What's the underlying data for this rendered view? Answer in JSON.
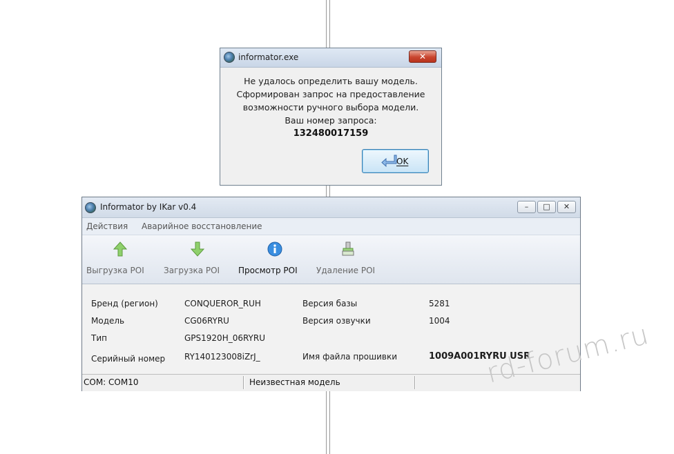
{
  "dialog": {
    "title": "informator.exe",
    "close_glyph": "✕",
    "lines": [
      "Не удалось определить вашу модель.",
      "Сформирован запрос на предоставление",
      "возможности ручного выбора модели.",
      "Ваш номер запроса:"
    ],
    "request_number": "132480017159",
    "ok_label": "OK",
    "ok_icon": "enter-arrow-icon"
  },
  "main_window": {
    "title": "Informator by IKar v0.4",
    "window_buttons": {
      "minimize": "–",
      "maximize": "□",
      "close": "✕"
    },
    "menu": [
      "Действия",
      "Аварийное восстановление"
    ],
    "toolbar": [
      {
        "label": "Выгрузка POI",
        "icon": "arrow-up-icon",
        "color": "#7fbf5f"
      },
      {
        "label": "Загрузка POI",
        "icon": "arrow-down-icon",
        "color": "#7fbf5f"
      },
      {
        "label": "Просмотр POI",
        "icon": "info-icon",
        "color": "#2f7fd0"
      },
      {
        "label": "Удаление POI",
        "icon": "eraser-icon",
        "color": "#6aa85a"
      }
    ],
    "info": {
      "brand_label": "Бренд (регион)",
      "brand_value": "CONQUEROR_RUH",
      "model_label": "Модель",
      "model_value": "CG06RYRU",
      "type_label": "Тип",
      "type_value": "GPS1920H_06RYRU",
      "serial_label": "Серийный номер",
      "serial_value": "RY140123008iZrJ_",
      "db_version_label": "Версия базы",
      "db_version_value": "5281",
      "voice_version_label": "Версия озвучки",
      "voice_version_value": "1004",
      "firmware_label": "Имя файла прошивки",
      "firmware_value": "1009A001RYRU USR"
    },
    "status": {
      "port": "COM: COM10",
      "model": "Неизвестная модель"
    }
  },
  "watermark": "rd-forum.ru"
}
